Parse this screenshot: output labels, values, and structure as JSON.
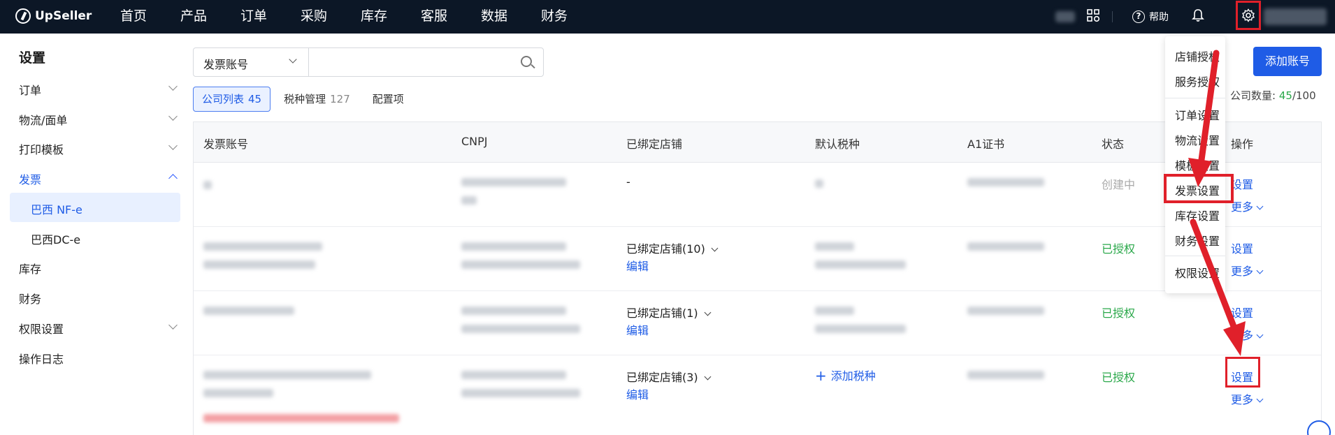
{
  "app": {
    "logo_text": "UpSeller",
    "nav": [
      "首页",
      "产品",
      "订单",
      "采购",
      "库存",
      "客服",
      "数据",
      "财务"
    ],
    "help_label": "帮助",
    "help_icon_glyph": "?"
  },
  "sidebar": {
    "title": "设置",
    "items": [
      {
        "label": "订单",
        "chevron": "down"
      },
      {
        "label": "物流/面单",
        "chevron": "down"
      },
      {
        "label": "打印模板",
        "chevron": "down"
      },
      {
        "label": "发票",
        "chevron": "up"
      },
      {
        "label": "巴西 NF-e",
        "sub": true,
        "selected": true
      },
      {
        "label": "巴西DC-e",
        "sub": true
      },
      {
        "label": "库存"
      },
      {
        "label": "财务"
      },
      {
        "label": "权限设置",
        "chevron": "down"
      },
      {
        "label": "操作日志"
      }
    ]
  },
  "search": {
    "select_value": "发票账号",
    "placeholder": ""
  },
  "tabs": [
    {
      "label": "公司列表",
      "count": "45",
      "active": true
    },
    {
      "label": "税种管理",
      "count": "127"
    },
    {
      "label": "配置项",
      "count": ""
    }
  ],
  "toolbar": {
    "add_button": "添加账号",
    "company_count_label": "公司数量:",
    "company_count_value": "45",
    "company_count_max": "/100"
  },
  "table": {
    "headers": [
      "发票账号",
      "CNPJ",
      "已绑定店铺",
      "默认税种",
      "A1证书",
      "状态",
      "操作"
    ],
    "rows": [
      {
        "bound_shops": "-",
        "default_tax": "",
        "status": "创建中",
        "status_type": "gray",
        "action_primary": "设置",
        "action_more": "更多"
      },
      {
        "bound_shops": "已绑定店铺(10)",
        "edit": "编辑",
        "default_tax": "",
        "status": "已授权",
        "status_type": "green",
        "action_primary": "设置",
        "action_more": "更多"
      },
      {
        "bound_shops": "已绑定店铺(1)",
        "edit": "编辑",
        "default_tax": "",
        "status": "已授权",
        "status_type": "green",
        "action_primary": "设置",
        "action_more": "更多"
      },
      {
        "bound_shops": "已绑定店铺(3)",
        "edit": "编辑",
        "default_tax": "添加税种",
        "status": "已授权",
        "status_type": "green",
        "action_primary": "设置",
        "action_more": "更多"
      }
    ]
  },
  "settings_menu": {
    "items": [
      "店铺授权",
      "服务授权",
      "订单设置",
      "物流设置",
      "模板设置",
      "发票设置",
      "库存设置",
      "财务设置",
      "权限设置"
    ],
    "highlighted": "发票设置"
  },
  "colors": {
    "topbar": "#0c1726",
    "accent": "#1f5ce6",
    "success": "#2aa84a",
    "annotation": "#e0202a"
  }
}
